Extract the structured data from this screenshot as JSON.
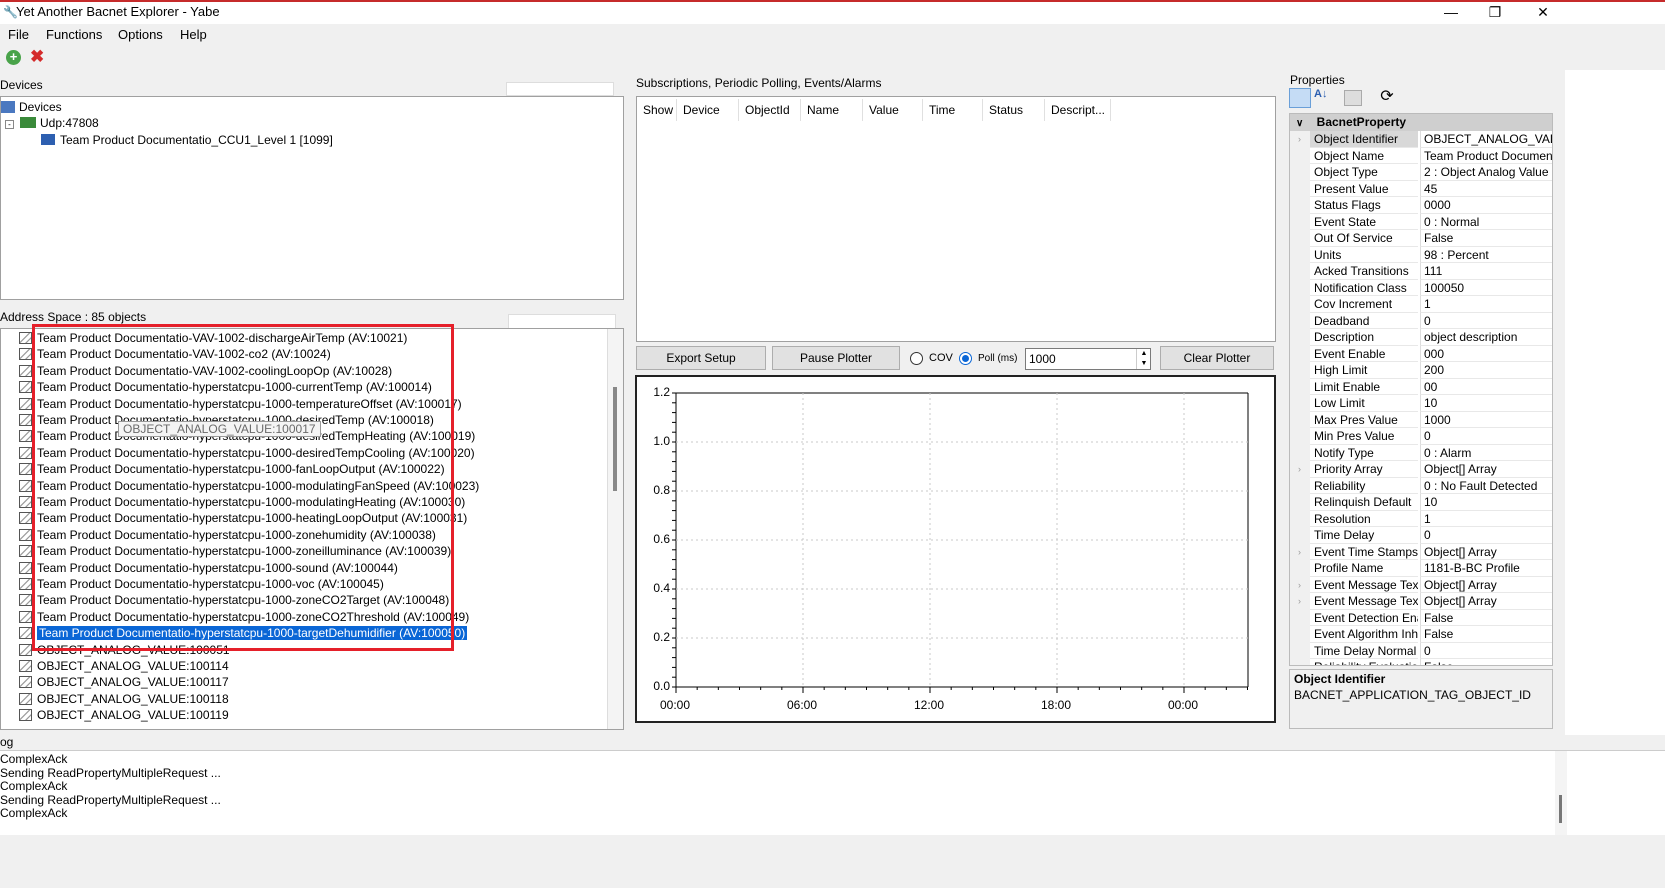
{
  "window": {
    "title": "Yet Another Bacnet Explorer - Yabe",
    "minimize": "—",
    "maximize": "❐",
    "close": "✕"
  },
  "menu": [
    "File",
    "Functions",
    "Options",
    "Help"
  ],
  "devices": {
    "header": "Devices",
    "nodes": [
      "Devices",
      "Udp:47808",
      "Team Product Documentatio_CCU1_Level 1 [1099]"
    ]
  },
  "address_space": {
    "header": "Address Space : 85 objects",
    "items": [
      "Team Product Documentatio-VAV-1002-dischargeAirTemp (AV:10021)",
      "Team Product Documentatio-VAV-1002-co2 (AV:10024)",
      "Team Product Documentatio-VAV-1002-coolingLoopOp (AV:10028)",
      "Team Product Documentatio-hyperstatcpu-1000-currentTemp (AV:100014)",
      "Team Product Documentatio-hyperstatcpu-1000-temperatureOffset (AV:100017)",
      "Team Product Documentatio-hyperstatcpu-1000-desiredTemp (AV:100018)",
      "Team Product Documentatio-hyperstatcpu-1000-desiredTempHeating (AV:100019)",
      "Team Product Documentatio-hyperstatcpu-1000-desiredTempCooling (AV:100020)",
      "Team Product Documentatio-hyperstatcpu-1000-fanLoopOutput (AV:100022)",
      "Team Product Documentatio-hyperstatcpu-1000-modulatingFanSpeed (AV:100023)",
      "Team Product Documentatio-hyperstatcpu-1000-modulatingHeating (AV:100030)",
      "Team Product Documentatio-hyperstatcpu-1000-heatingLoopOutput (AV:100031)",
      "Team Product Documentatio-hyperstatcpu-1000-zonehumidity (AV:100038)",
      "Team Product Documentatio-hyperstatcpu-1000-zoneilluminance (AV:100039)",
      "Team Product Documentatio-hyperstatcpu-1000-sound (AV:100044)",
      "Team Product Documentatio-hyperstatcpu-1000-voc (AV:100045)",
      "Team Product Documentatio-hyperstatcpu-1000-zoneCO2Target (AV:100048)",
      "Team Product Documentatio-hyperstatcpu-1000-zoneCO2Threshold (AV:100049)",
      "Team Product Documentatio-hyperstatcpu-1000-targetDehumidifier (AV:100050)",
      "OBJECT_ANALOG_VALUE:100051",
      "OBJECT_ANALOG_VALUE:100114",
      "OBJECT_ANALOG_VALUE:100117",
      "OBJECT_ANALOG_VALUE:100118",
      "OBJECT_ANALOG_VALUE:100119"
    ],
    "tooltip": "OBJECT_ANALOG_VALUE:100017"
  },
  "subscriptions": {
    "header": "Subscriptions, Periodic Polling, Events/Alarms",
    "columns": [
      "Show",
      "Device",
      "ObjectId",
      "Name",
      "Value",
      "Time",
      "Status",
      "Descript..."
    ]
  },
  "plot_controls": {
    "export": "Export Setup",
    "pause": "Pause Plotter",
    "cov": "COV",
    "poll": "Poll (ms)",
    "poll_value": "1000",
    "clear": "Clear Plotter"
  },
  "chart_data": {
    "type": "line",
    "series": [],
    "yticks": [
      "1.2",
      "1.0",
      "0.8",
      "0.6",
      "0.4",
      "0.2",
      "0.0"
    ],
    "xticks": [
      "00:00",
      "06:00",
      "12:00",
      "18:00",
      "00:00"
    ],
    "ylim": [
      0,
      1.2
    ],
    "grid": true
  },
  "properties": {
    "header": "Properties",
    "category": "BacnetProperty",
    "rows": [
      [
        "Object Identifier",
        "OBJECT_ANALOG_VALU"
      ],
      [
        "Object Name",
        "Team Product Documenta"
      ],
      [
        "Object Type",
        "2 : Object Analog Value"
      ],
      [
        "Present Value",
        "45"
      ],
      [
        "Status Flags",
        "0000"
      ],
      [
        "Event State",
        "0 : Normal"
      ],
      [
        "Out Of Service",
        "False"
      ],
      [
        "Units",
        "98 : Percent"
      ],
      [
        "Acked Transitions",
        "111"
      ],
      [
        "Notification Class",
        "100050"
      ],
      [
        "Cov Increment",
        "1"
      ],
      [
        "Deadband",
        "0"
      ],
      [
        "Description",
        "object description"
      ],
      [
        "Event Enable",
        "000"
      ],
      [
        "High Limit",
        "200"
      ],
      [
        "Limit Enable",
        "00"
      ],
      [
        "Low Limit",
        "10"
      ],
      [
        "Max Pres Value",
        "1000"
      ],
      [
        "Min Pres Value",
        "0"
      ],
      [
        "Notify Type",
        "0 : Alarm"
      ],
      [
        "Priority Array",
        "Object[] Array"
      ],
      [
        "Reliability",
        "0 : No Fault Detected"
      ],
      [
        "Relinquish Default",
        "10"
      ],
      [
        "Resolution",
        "1"
      ],
      [
        "Time Delay",
        "0"
      ],
      [
        "Event Time Stamps",
        "Object[] Array"
      ],
      [
        "Profile Name",
        "1181-B-BC Profile"
      ],
      [
        "Event Message Texts",
        "Object[] Array"
      ],
      [
        "Event Message Texts",
        "Object[] Array"
      ],
      [
        "Event Detection Enat",
        "False"
      ],
      [
        "Event Algorithm Inhibi",
        "False"
      ],
      [
        "Time Delay Normal",
        "0"
      ],
      [
        "Reliability Evaluation I",
        "False"
      ]
    ],
    "desc_title": "Object Identifier",
    "desc_text": "BACNET_APPLICATION_TAG_OBJECT_ID"
  },
  "log": {
    "header": "og",
    "lines": [
      "ComplexAck",
      "Sending ReadPropertyMultipleRequest ...",
      "ComplexAck",
      "Sending ReadPropertyMultipleRequest ...",
      "ComplexAck"
    ]
  },
  "colors": {
    "highlight_box": "#e5202a",
    "selection": "#0a66d6",
    "title_accent": "#c62b2b"
  }
}
